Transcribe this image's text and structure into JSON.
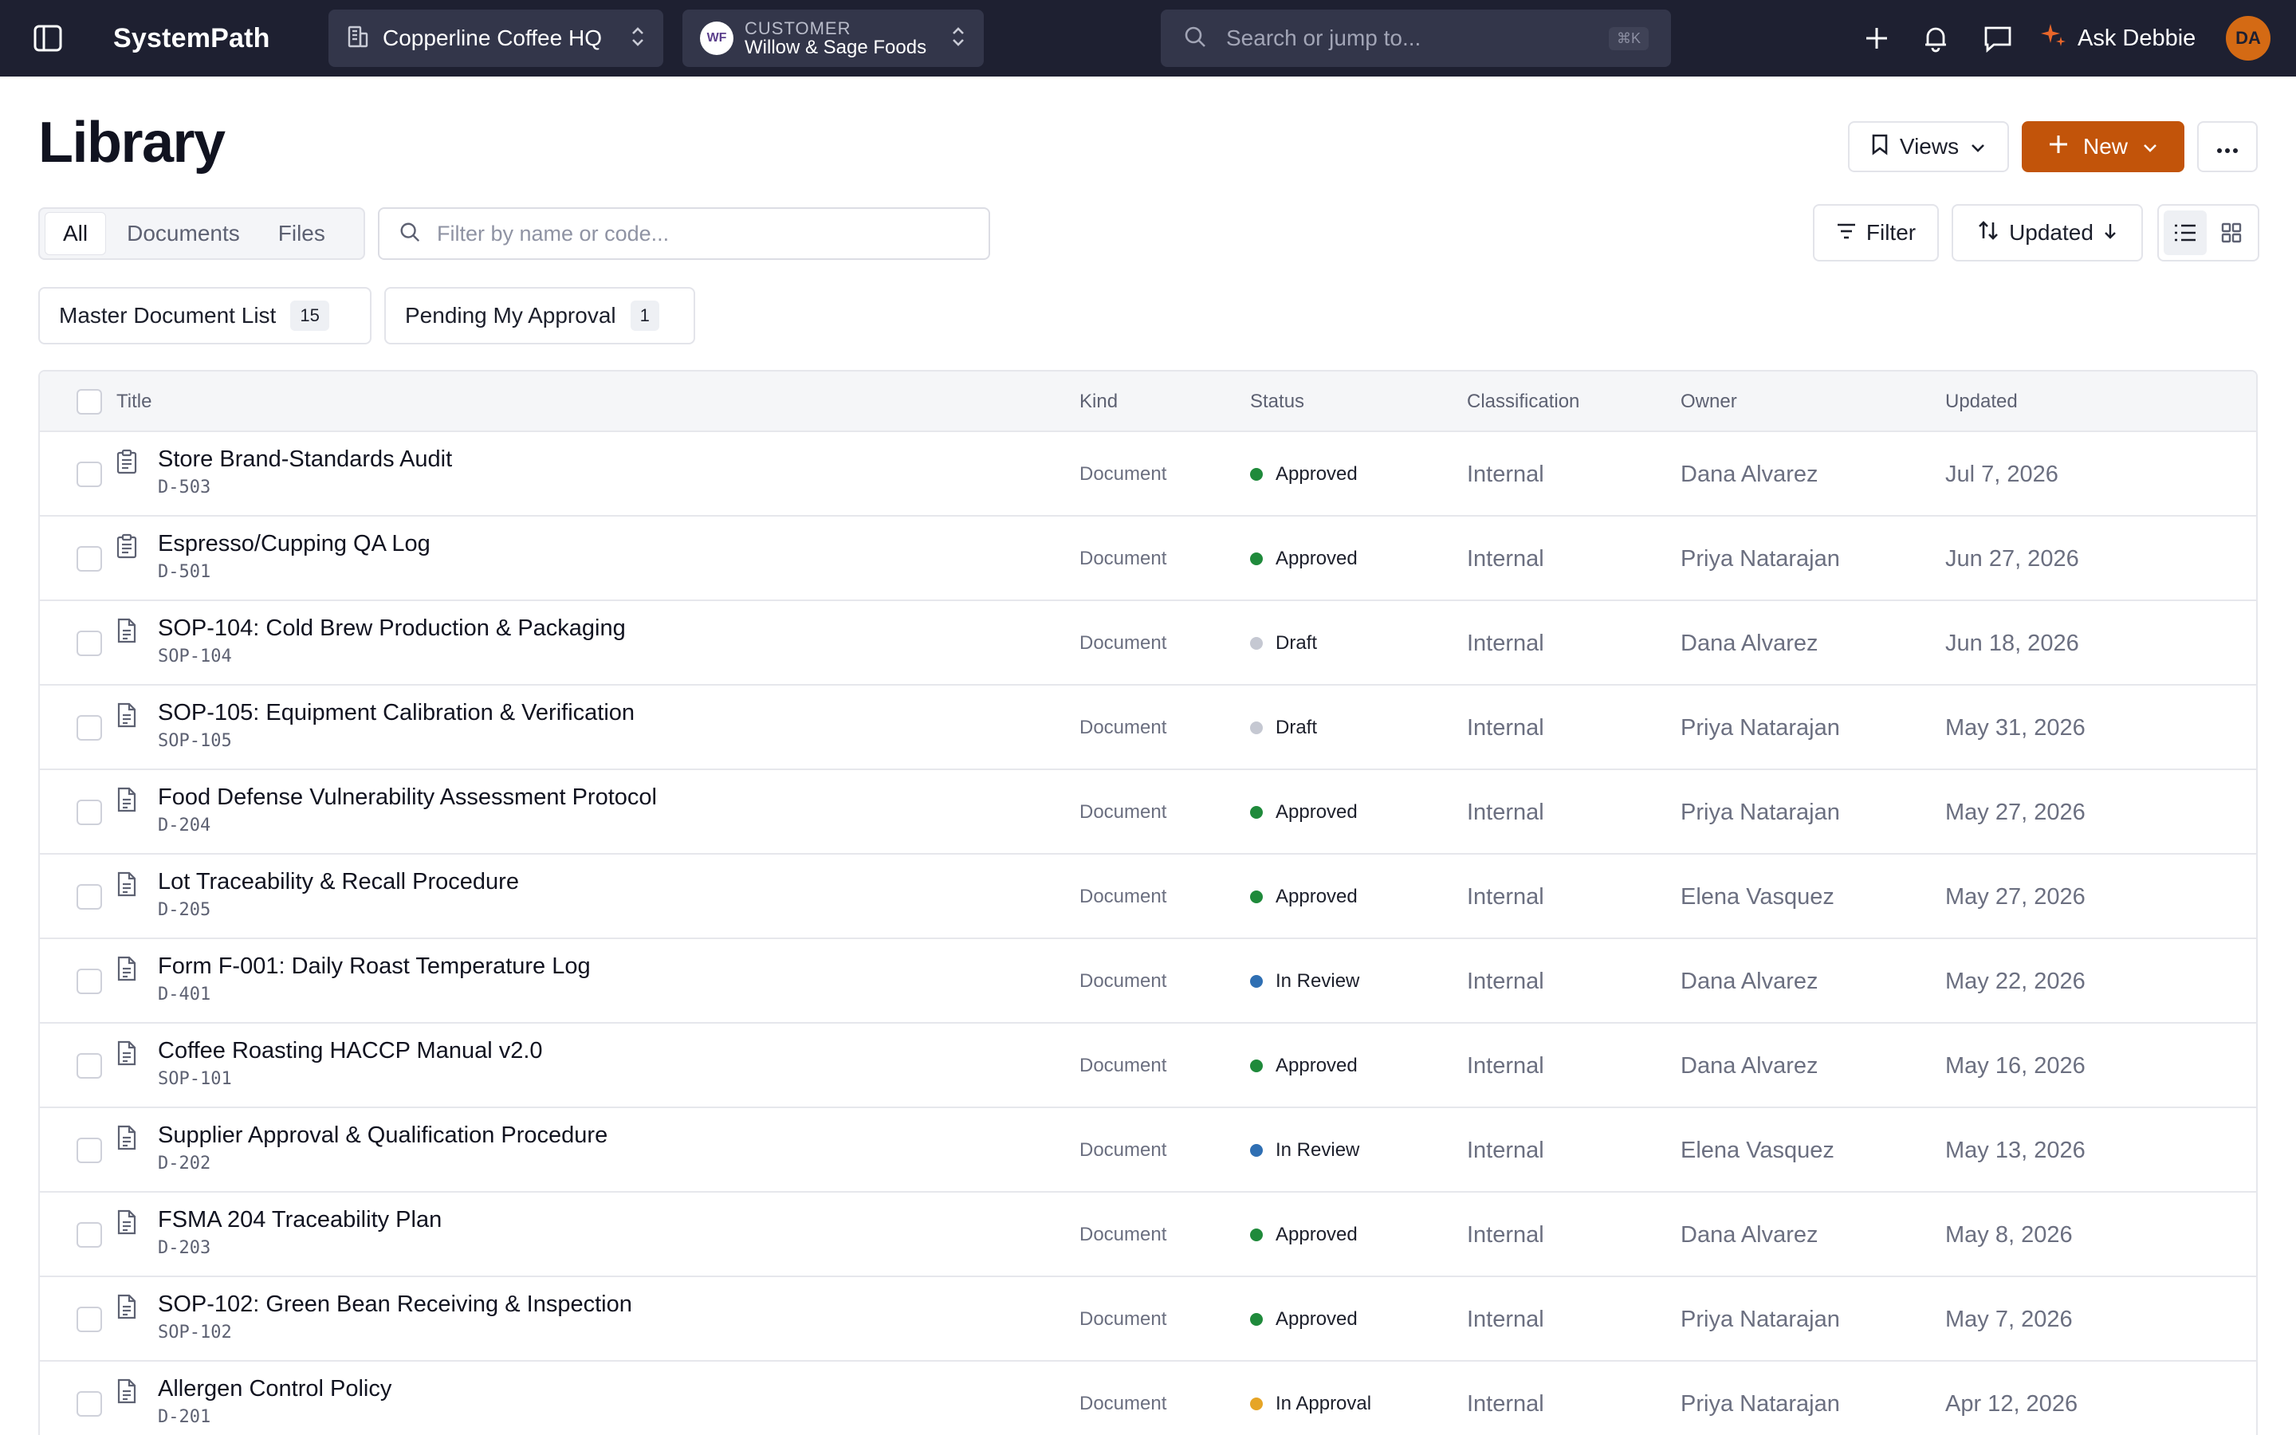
{
  "topbar": {
    "brand": "SystemPath",
    "workspace": "Copperline Coffee HQ",
    "customer_kicker": "CUSTOMER",
    "customer_name": "Willow & Sage Foods",
    "customer_initials": "WF",
    "search_placeholder": "Search or jump to...",
    "search_shortcut": "⌘K",
    "assistant_label": "Ask Debbie",
    "user_initials": "DA"
  },
  "page": {
    "title": "Library",
    "views_label": "Views",
    "new_label": "New"
  },
  "toolbar": {
    "tabs": [
      "All",
      "Documents",
      "Files"
    ],
    "active_tab": "All",
    "filter_placeholder": "Filter by name or code...",
    "filter_label": "Filter",
    "sort_label": "Updated"
  },
  "saved_views": [
    {
      "label": "Master Document List",
      "count": "15"
    },
    {
      "label": "Pending My Approval",
      "count": "1"
    }
  ],
  "table": {
    "columns": {
      "title": "Title",
      "kind": "Kind",
      "status": "Status",
      "classification": "Classification",
      "owner": "Owner",
      "updated": "Updated"
    },
    "rows": [
      {
        "icon": "clipboard",
        "title": "Store Brand-Standards Audit",
        "code": "D-503",
        "kind": "Document",
        "status": "Approved",
        "classification": "Internal",
        "owner": "Dana Alvarez",
        "updated": "Jul 7, 2026"
      },
      {
        "icon": "clipboard",
        "title": "Espresso/Cupping QA Log",
        "code": "D-501",
        "kind": "Document",
        "status": "Approved",
        "classification": "Internal",
        "owner": "Priya Natarajan",
        "updated": "Jun 27, 2026"
      },
      {
        "icon": "document",
        "title": "SOP-104: Cold Brew Production & Packaging",
        "code": "SOP-104",
        "kind": "Document",
        "status": "Draft",
        "classification": "Internal",
        "owner": "Dana Alvarez",
        "updated": "Jun 18, 2026"
      },
      {
        "icon": "document",
        "title": "SOP-105: Equipment Calibration & Verification",
        "code": "SOP-105",
        "kind": "Document",
        "status": "Draft",
        "classification": "Internal",
        "owner": "Priya Natarajan",
        "updated": "May 31, 2026"
      },
      {
        "icon": "document",
        "title": "Food Defense Vulnerability Assessment Protocol",
        "code": "D-204",
        "kind": "Document",
        "status": "Approved",
        "classification": "Internal",
        "owner": "Priya Natarajan",
        "updated": "May 27, 2026"
      },
      {
        "icon": "document",
        "title": "Lot Traceability & Recall Procedure",
        "code": "D-205",
        "kind": "Document",
        "status": "Approved",
        "classification": "Internal",
        "owner": "Elena Vasquez",
        "updated": "May 27, 2026"
      },
      {
        "icon": "document",
        "title": "Form F-001: Daily Roast Temperature Log",
        "code": "D-401",
        "kind": "Document",
        "status": "In Review",
        "classification": "Internal",
        "owner": "Dana Alvarez",
        "updated": "May 22, 2026"
      },
      {
        "icon": "document",
        "title": "Coffee Roasting HACCP Manual v2.0",
        "code": "SOP-101",
        "kind": "Document",
        "status": "Approved",
        "classification": "Internal",
        "owner": "Dana Alvarez",
        "updated": "May 16, 2026"
      },
      {
        "icon": "document",
        "title": "Supplier Approval & Qualification Procedure",
        "code": "D-202",
        "kind": "Document",
        "status": "In Review",
        "classification": "Internal",
        "owner": "Elena Vasquez",
        "updated": "May 13, 2026"
      },
      {
        "icon": "document",
        "title": "FSMA 204 Traceability Plan",
        "code": "D-203",
        "kind": "Document",
        "status": "Approved",
        "classification": "Internal",
        "owner": "Dana Alvarez",
        "updated": "May 8, 2026"
      },
      {
        "icon": "document",
        "title": "SOP-102: Green Bean Receiving & Inspection",
        "code": "SOP-102",
        "kind": "Document",
        "status": "Approved",
        "classification": "Internal",
        "owner": "Priya Natarajan",
        "updated": "May 7, 2026"
      },
      {
        "icon": "document",
        "title": "Allergen Control Policy",
        "code": "D-201",
        "kind": "Document",
        "status": "In Approval",
        "classification": "Internal",
        "owner": "Priya Natarajan",
        "updated": "Apr 12, 2026"
      }
    ]
  },
  "status_colors": {
    "Approved": "#1f8a3b",
    "Draft": "#c5c8d2",
    "In Review": "#2f6fb3",
    "In Approval": "#e6a526"
  },
  "colors": {
    "topbar_bg": "#1e2031",
    "accent": "#c2540a",
    "user_avatar": "#d46a14"
  }
}
